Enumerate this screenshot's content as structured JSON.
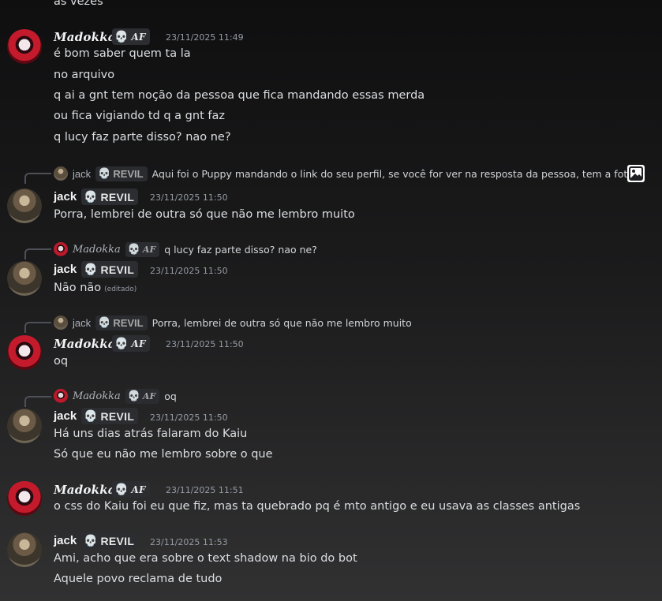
{
  "partial_top": "as vezes",
  "users": {
    "madokka": {
      "name": "Madokka",
      "tag": "AF",
      "tag_icon": "skull-purple-icon"
    },
    "jack": {
      "name": "jack",
      "tag": "REVIL",
      "tag_icon": "skull-white-icon"
    }
  },
  "messages": [
    {
      "author": "Madokka",
      "timestamp": "23/11/2025 11:49",
      "lines": [
        "é bom saber quem ta la",
        "no arquivo",
        "q ai a gnt tem noção da pessoa que fica mandando essas merda",
        "ou fica vigiando td q a gnt faz",
        "q lucy faz parte disso? nao ne?"
      ]
    },
    {
      "author": "jack",
      "timestamp": "23/11/2025 11:50",
      "reply": {
        "author": "jack",
        "tag": "REVIL",
        "text": "Aqui foi o Puppy mandando o link do seu perfil, se você for ver na resposta da pessoa, tem a foti...",
        "icon": "image-icon"
      },
      "lines": [
        "Porra, lembrei de outra só que não me lembro muito"
      ]
    },
    {
      "author": "jack",
      "timestamp": "23/11/2025 11:50",
      "reply": {
        "author": "Madokka",
        "tag": "AF",
        "text": "q lucy faz parte disso? nao ne?"
      },
      "lines": [
        "Não não"
      ],
      "edited": "(editado)"
    },
    {
      "author": "Madokka",
      "timestamp": "23/11/2025 11:50",
      "reply": {
        "author": "jack",
        "tag": "REVIL",
        "text": "Porra, lembrei de outra só que não me lembro muito"
      },
      "lines": [
        "oq"
      ]
    },
    {
      "author": "jack",
      "timestamp": "23/11/2025 11:50",
      "reply": {
        "author": "Madokka",
        "tag": "AF",
        "text": "oq"
      },
      "lines": [
        "Há uns dias atrás falaram do Kaiu",
        "Só que eu não me lembro sobre o que"
      ]
    },
    {
      "author": "Madokka",
      "timestamp": "23/11/2025 11:51",
      "lines": [
        "o css do Kaiu foi eu que fiz, mas ta quebrado pq é mto antigo e eu usava as classes antigas"
      ]
    },
    {
      "author": "jack",
      "timestamp": "23/11/2025 11:53",
      "lines": [
        "Ami, acho que era sobre o text shadow na bio do bot",
        "Aquele povo reclama de tudo"
      ]
    }
  ]
}
